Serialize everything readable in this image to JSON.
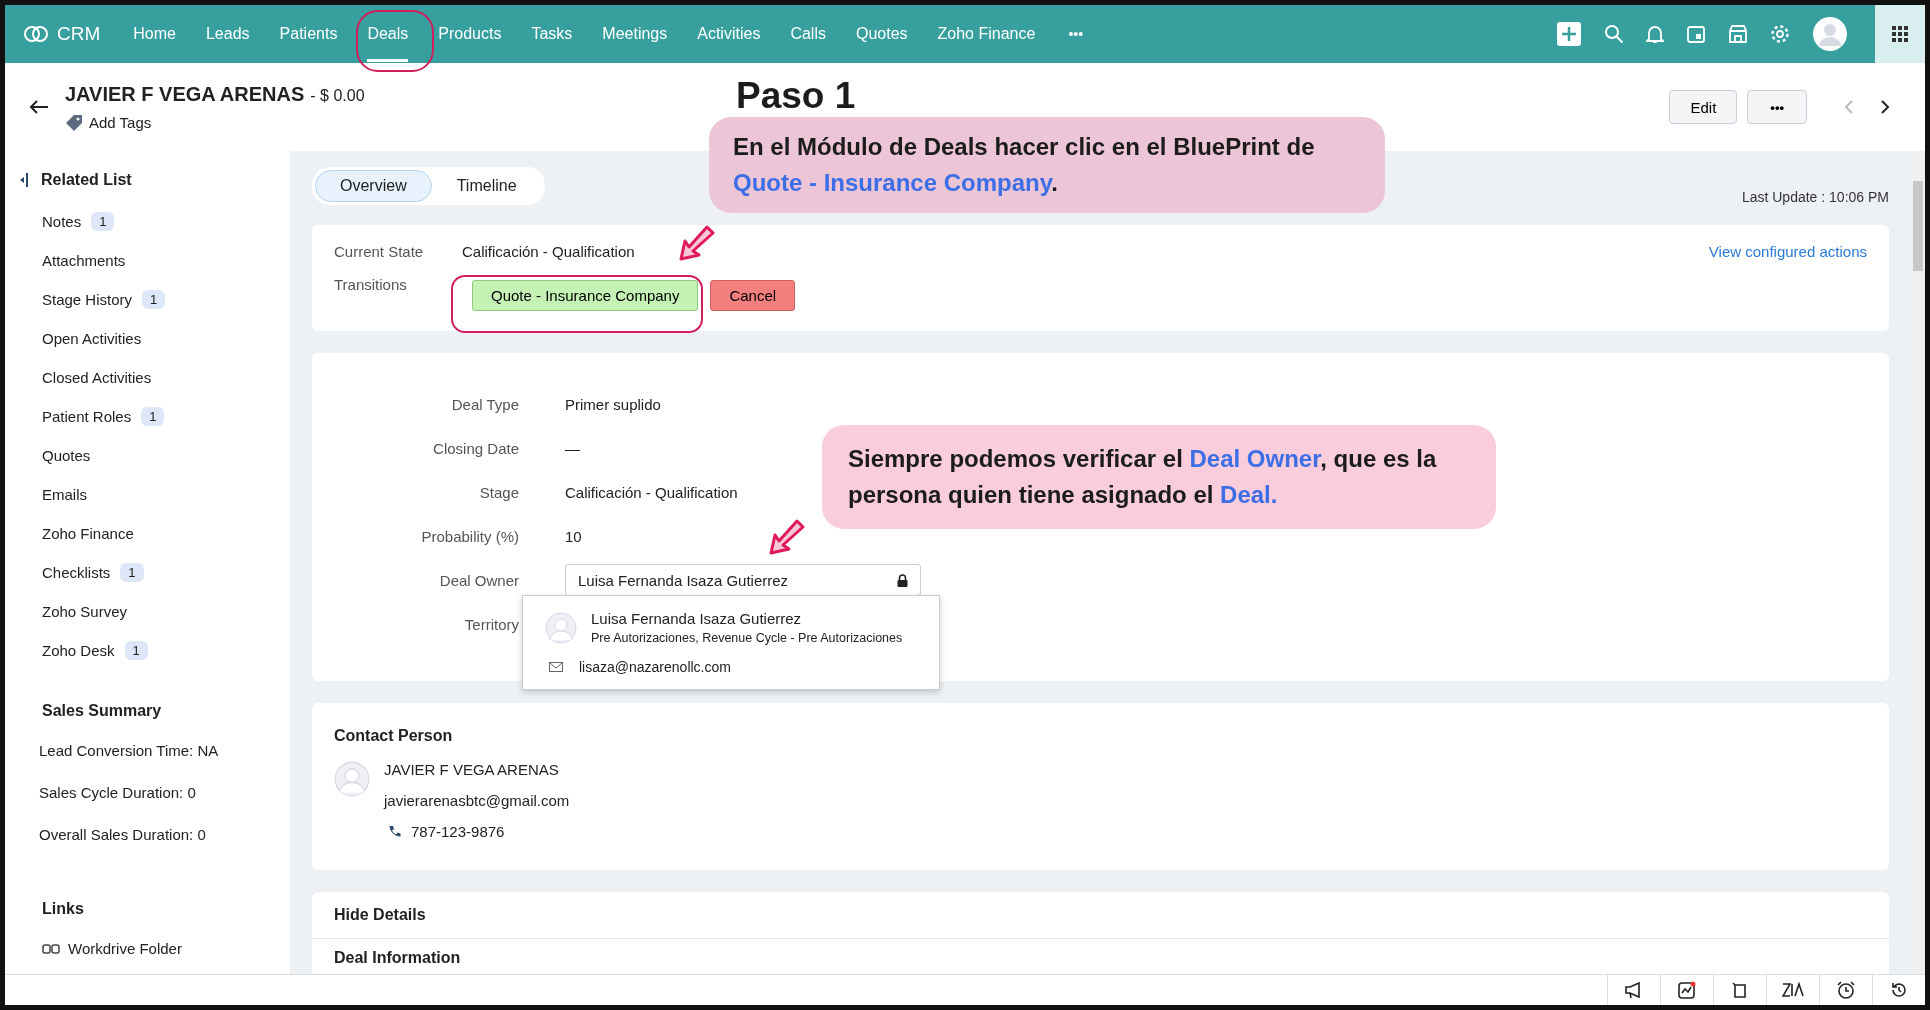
{
  "topbar": {
    "logo": "CRM",
    "nav": [
      {
        "label": "Home",
        "selected": false
      },
      {
        "label": "Leads",
        "selected": false
      },
      {
        "label": "Patients",
        "selected": false
      },
      {
        "label": "Deals",
        "selected": true
      },
      {
        "label": "Products",
        "selected": false
      },
      {
        "label": "Tasks",
        "selected": false
      },
      {
        "label": "Meetings",
        "selected": false
      },
      {
        "label": "Activities",
        "selected": false
      },
      {
        "label": "Calls",
        "selected": false
      },
      {
        "label": "Quotes",
        "selected": false
      },
      {
        "label": "Zoho Finance",
        "selected": false
      }
    ],
    "more": "•••"
  },
  "header": {
    "title": "JAVIER F VEGA ARENAS",
    "amount": "- $ 0.00",
    "add_tags": "Add Tags",
    "edit": "Edit",
    "more": "•••"
  },
  "sidebar": {
    "related_title": "Related List",
    "items": [
      {
        "label": "Notes",
        "count": "1"
      },
      {
        "label": "Attachments"
      },
      {
        "label": "Stage History",
        "count": "1"
      },
      {
        "label": "Open Activities"
      },
      {
        "label": "Closed Activities"
      },
      {
        "label": "Patient Roles",
        "count": "1"
      },
      {
        "label": "Quotes"
      },
      {
        "label": "Emails"
      },
      {
        "label": "Zoho Finance"
      },
      {
        "label": "Checklists",
        "count": "1"
      },
      {
        "label": "Zoho Survey"
      },
      {
        "label": "Zoho Desk",
        "count": "1"
      }
    ],
    "summary_title": "Sales Summary",
    "summary": [
      "Lead Conversion Time: NA",
      "Sales Cycle Duration: 0",
      "Overall Sales Duration: 0"
    ],
    "links_title": "Links",
    "links": [
      "Workdrive Folder"
    ]
  },
  "view_tabs": [
    {
      "label": "Overview",
      "selected": true
    },
    {
      "label": "Timeline",
      "selected": false
    }
  ],
  "last_update": "Last Update : 10:06 PM",
  "blueprint": {
    "current_state_label": "Current State",
    "current_state": "Calificación - Qualification",
    "transitions_label": "Transitions",
    "transitions": [
      {
        "label": "Quote - Insurance Company",
        "kind": "proceed"
      },
      {
        "label": "Cancel",
        "kind": "cancel"
      }
    ],
    "view_actions": "View configured actions"
  },
  "fields": [
    {
      "label": "Deal Type",
      "value": "Primer suplido"
    },
    {
      "label": "Closing Date",
      "value": "—"
    },
    {
      "label": "Stage",
      "value": "Calificación - Qualification"
    },
    {
      "label": "Probability (%)",
      "value": "10"
    },
    {
      "label": "Deal Owner",
      "value": "Luisa Fernanda Isaza Gutierrez",
      "kind": "locked"
    },
    {
      "label": "Territory"
    }
  ],
  "owner_popup": {
    "name": "Luisa Fernanda Isaza Gutierrez",
    "role": "Pre Autorizaciones, Revenue Cycle - Pre Autorizaciones",
    "email": "lisaza@nazarenollc.com"
  },
  "contact": {
    "title": "Contact Person",
    "name": "JAVIER F VEGA ARENAS",
    "email": "javierarenasbtc@gmail.com",
    "phone": "787-123-9876"
  },
  "details": {
    "title": "Hide Details",
    "section": "Deal Information"
  },
  "annotations": {
    "title": "Paso 1",
    "callouts": [
      [
        {
          "text": "En el Módulo de Deals hacer clic en el BluePrint de ",
          "highlight": false
        },
        {
          "text": "Quote - Insurance Company",
          "highlight": true
        },
        {
          "text": ".",
          "highlight": false
        }
      ],
      [
        {
          "text": "Siempre podemos verificar el ",
          "highlight": false
        },
        {
          "text": "Deal Owner",
          "highlight": true
        },
        {
          "text": ", que es la persona quien tiene asignado el ",
          "highlight": false
        },
        {
          "text": "Deal.",
          "highlight": true
        }
      ]
    ]
  }
}
